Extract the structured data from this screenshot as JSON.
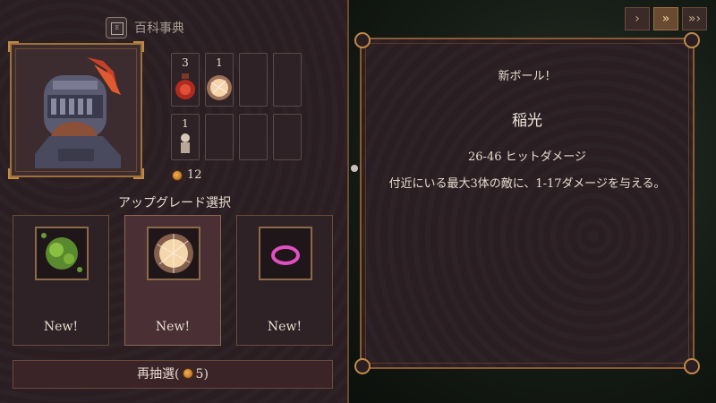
{
  "header": {
    "encyclopedia_label": "百科事典",
    "encyclopedia_glyph": "E"
  },
  "portrait": {
    "icon": "knight-helmet-icon"
  },
  "inventory": {
    "slots": [
      {
        "count": "3",
        "icon": "red-potion-icon"
      },
      {
        "count": "1",
        "icon": "lightning-orb-icon"
      },
      {
        "count": "",
        "icon": ""
      },
      {
        "count": "",
        "icon": ""
      },
      {
        "count": "1",
        "icon": "small-figure-icon"
      },
      {
        "count": "",
        "icon": ""
      },
      {
        "count": "",
        "icon": ""
      },
      {
        "count": "",
        "icon": ""
      }
    ],
    "gold": "12"
  },
  "upgrade": {
    "title": "アップグレード選択",
    "cards": [
      {
        "label": "New!",
        "icon": "green-poison-orb-icon",
        "selected": false
      },
      {
        "label": "New!",
        "icon": "lightning-orb-icon",
        "selected": true
      },
      {
        "label": "New!",
        "icon": "pink-ring-icon",
        "selected": false
      }
    ],
    "reroll_prefix": "再抽選(",
    "reroll_cost": "5",
    "reroll_suffix": ")"
  },
  "speed_controls": [
    {
      "label": "›",
      "icon": "speed-1-icon",
      "active": false
    },
    {
      "label": "»",
      "icon": "speed-2-icon",
      "active": true
    },
    {
      "label": "»›",
      "icon": "speed-3-icon",
      "active": false
    }
  ],
  "detail": {
    "heading": "新ボール！",
    "name": "稲光",
    "damage": "26-46 ヒットダメージ",
    "description": "付近にいる最大3体の敵に、1-17ダメージを与える。"
  },
  "colors": {
    "panel": "#2a1e22",
    "frame_gold": "#c08a48",
    "text": "#e8dcd0",
    "selected_card": "#4a3034"
  }
}
